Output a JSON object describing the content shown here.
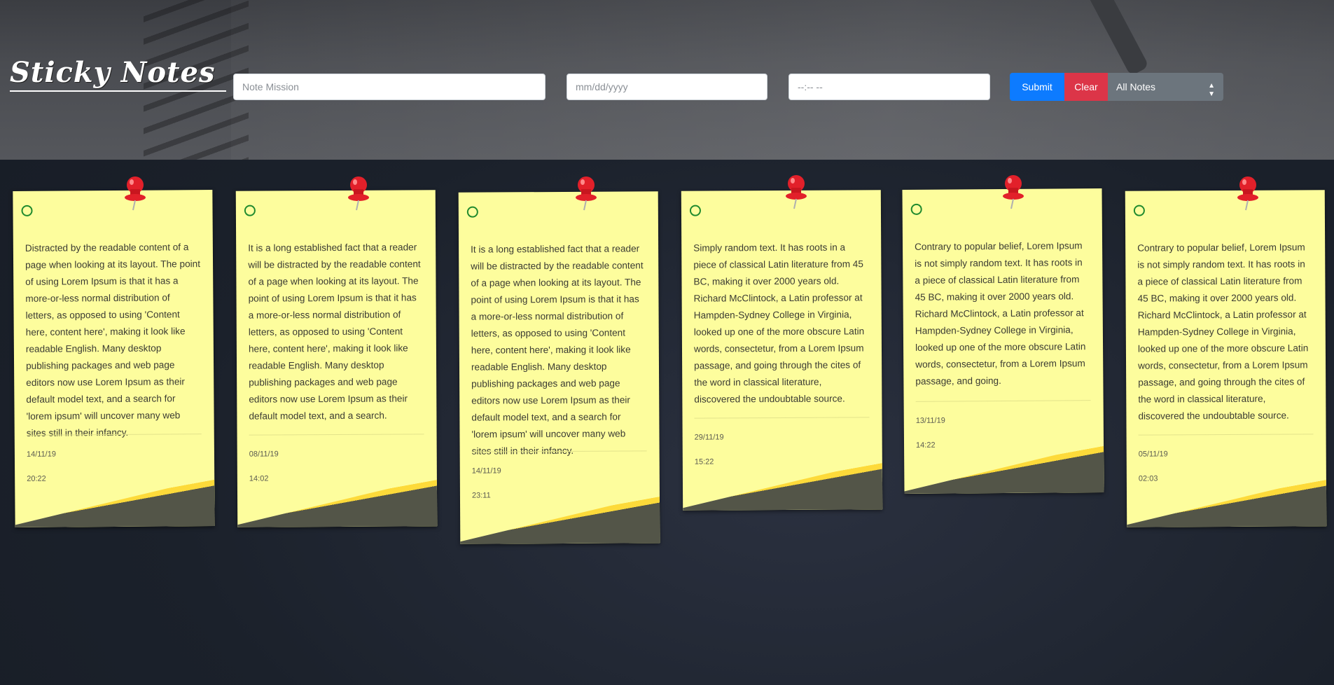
{
  "app": {
    "title": "Sticky Notes"
  },
  "form": {
    "mission_placeholder": "Note Mission",
    "date_placeholder": "mm/dd/yyyy",
    "time_placeholder": "--:-- --",
    "submit_label": "Submit",
    "clear_label": "Clear",
    "filter_selected": "All Notes"
  },
  "colors": {
    "submit": "#0d7bff",
    "clear": "#dc3548",
    "select": "#6c757d",
    "note": "#fdfd9d",
    "check": "#1f8a2e",
    "pin": "#e2202a"
  },
  "notes": [
    {
      "text": "Distracted by the readable content of a page when looking at its layout. The point of using Lorem Ipsum is that it has a more-or-less normal distribution of letters, as opposed to using 'Content here, content here', making it look like readable English. Many desktop publishing packages and web page editors now use Lorem Ipsum as their default model text, and a search for 'lorem ipsum' will uncover many web sites still in their infancy.",
      "date": "14/11/19",
      "time": "20:22"
    },
    {
      "text": "It is a long established fact that a reader will be distracted by the readable content of a page when looking at its layout. The point of using Lorem Ipsum is that it has a more-or-less normal distribution of letters, as opposed to using 'Content here, content here', making it look like readable English. Many desktop publishing packages and web page editors now use Lorem Ipsum as their default model text, and a search.",
      "date": "08/11/19",
      "time": "14:02"
    },
    {
      "text": "It is a long established fact that a reader will be distracted by the readable content of a page when looking at its layout. The point of using Lorem Ipsum is that it has a more-or-less normal distribution of letters, as opposed to using 'Content here, content here', making it look like readable English. Many desktop publishing packages and web page editors now use Lorem Ipsum as their default model text, and a search for 'lorem ipsum' will uncover many web sites still in their infancy.",
      "date": "14/11/19",
      "time": "23:11"
    },
    {
      "text": "Simply random text. It has roots in a piece of classical Latin literature from 45 BC, making it over 2000 years old. Richard McClintock, a Latin professor at Hampden-Sydney College in Virginia, looked up one of the more obscure Latin words, consectetur, from a Lorem Ipsum passage, and going through the cites of the word in classical literature, discovered the undoubtable source.",
      "date": "29/11/19",
      "time": "15:22"
    },
    {
      "text": "Contrary to popular belief, Lorem Ipsum is not simply random text. It has roots in a piece of classical Latin literature from 45 BC, making it over 2000 years old. Richard McClintock, a Latin professor at Hampden-Sydney College in Virginia, looked up one of the more obscure Latin words, consectetur, from a Lorem Ipsum passage, and going.",
      "date": "13/11/19",
      "time": "14:22"
    },
    {
      "text": "Contrary to popular belief, Lorem Ipsum is not simply random text. It has roots in a piece of classical Latin literature from 45 BC, making it over 2000 years old. Richard McClintock, a Latin professor at Hampden-Sydney College in Virginia, looked up one of the more obscure Latin words, consectetur, from a Lorem Ipsum passage, and going through the cites of the word in classical literature, discovered the undoubtable source.",
      "date": "05/11/19",
      "time": "02:03"
    }
  ]
}
